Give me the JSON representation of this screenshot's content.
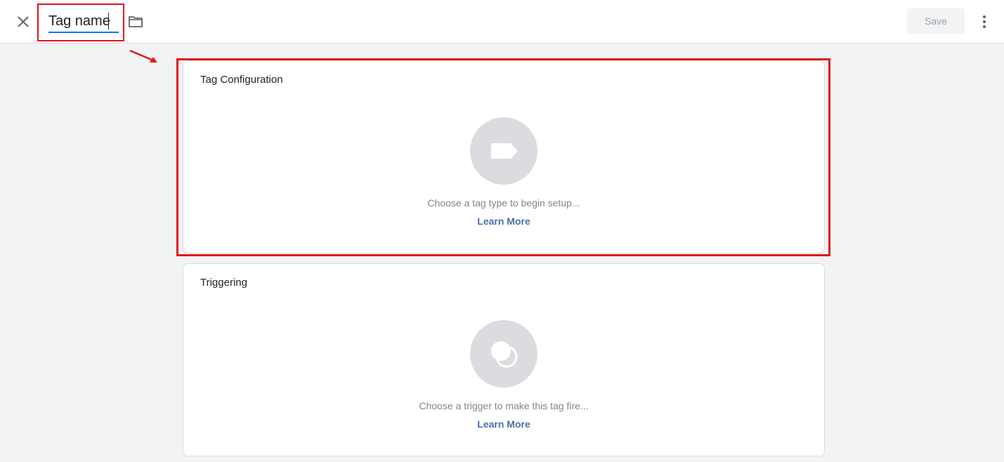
{
  "header": {
    "tag_name_value": "Tag name",
    "save_label": "Save",
    "close_icon": "close-icon",
    "folder_icon": "folder-icon",
    "more_icon": "more-vert-icon"
  },
  "cards": {
    "config": {
      "title": "Tag Configuration",
      "hint": "Choose a tag type to begin setup...",
      "link": "Learn More",
      "icon": "tag-icon"
    },
    "trigger": {
      "title": "Triggering",
      "hint": "Choose a trigger to make this tag fire...",
      "link": "Learn More",
      "icon": "trigger-icon"
    }
  },
  "annotations": {
    "highlight_color": "#e3131b"
  }
}
